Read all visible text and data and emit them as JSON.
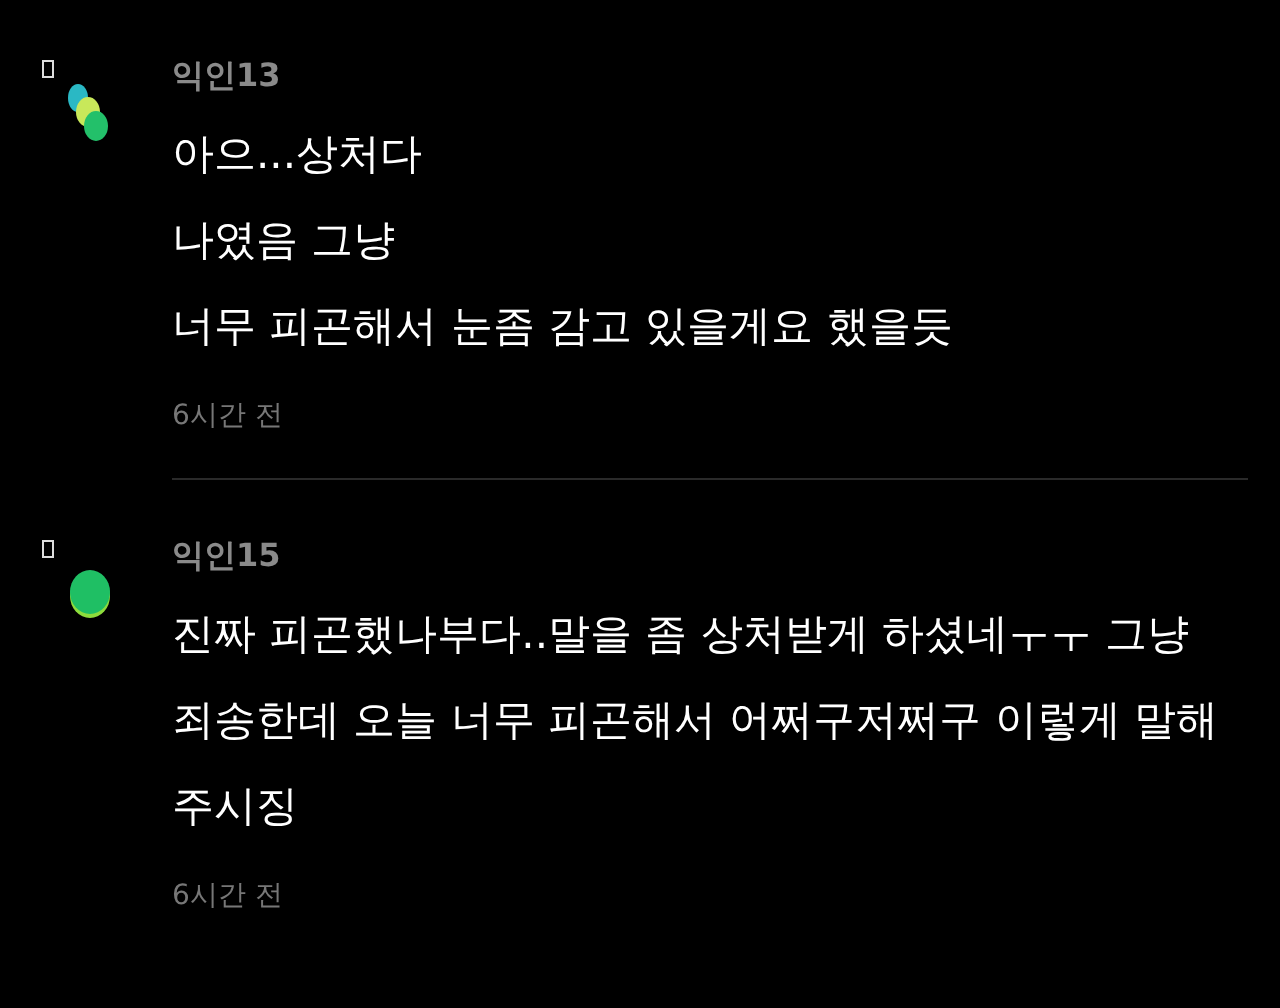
{
  "comments": [
    {
      "author": "익인13",
      "kind": "three-dots",
      "lines": [
        "아으...상처다",
        "나였음 그냥",
        "너무 피곤해서 눈좀 감고 있을게요 했을듯"
      ],
      "time": "6시간 전"
    },
    {
      "author": "익인15",
      "kind": "single",
      "lines": [
        "진짜 피곤했나부다..말을 좀 상처받게 하셨네ㅜㅜ 그냥 죄송한데 오늘 너무 피곤해서 어쩌구저쩌구 이렇게 말해 주시징"
      ],
      "time": "6시간 전"
    }
  ]
}
